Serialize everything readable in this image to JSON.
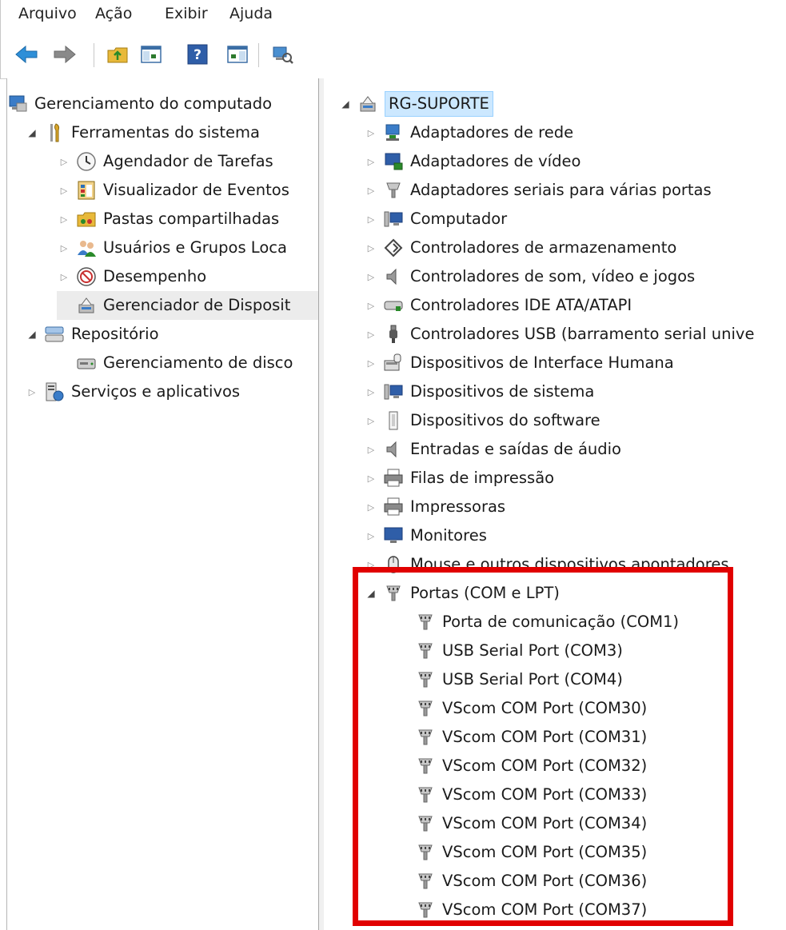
{
  "menu": [
    "Arquivo",
    "Ação",
    "Exibir",
    "Ajuda"
  ],
  "colors": {
    "accent_red": "#e10000",
    "selection": "#cce8ff"
  },
  "left_tree": [
    {
      "label": "Gerenciamento do computado",
      "icon": "computer-management-icon"
    },
    {
      "label": "Ferramentas do sistema",
      "icon": "tools-icon"
    },
    {
      "label": "Agendador de Tarefas",
      "icon": "clock-icon"
    },
    {
      "label": "Visualizador de Eventos",
      "icon": "event-viewer-icon"
    },
    {
      "label": "Pastas compartilhadas",
      "icon": "shared-folders-icon"
    },
    {
      "label": "Usuários e Grupos Loca",
      "icon": "users-icon"
    },
    {
      "label": "Desempenho",
      "icon": "performance-icon"
    },
    {
      "label": "Gerenciador de Disposit",
      "icon": "device-manager-icon"
    },
    {
      "label": "Repositório",
      "icon": "storage-icon"
    },
    {
      "label": "Gerenciamento de disco",
      "icon": "disk-icon"
    },
    {
      "label": "Serviços e aplicativos",
      "icon": "services-icon"
    }
  ],
  "right_tree": {
    "root": {
      "label": "RG-SUPORTE",
      "icon": "computer-icon"
    },
    "categories": [
      {
        "label": "Adaptadores de rede",
        "icon": "network-adapter-icon"
      },
      {
        "label": "Adaptadores de vídeo",
        "icon": "display-adapter-icon"
      },
      {
        "label": "Adaptadores seriais para várias portas",
        "icon": "serial-adapter-icon"
      },
      {
        "label": "Computador",
        "icon": "computer-icon"
      },
      {
        "label": "Controladores de armazenamento",
        "icon": "storage-controller-icon"
      },
      {
        "label": "Controladores de som, vídeo e jogos",
        "icon": "speaker-icon"
      },
      {
        "label": "Controladores IDE ATA/ATAPI",
        "icon": "ide-icon"
      },
      {
        "label": "Controladores USB (barramento serial unive",
        "icon": "usb-icon"
      },
      {
        "label": "Dispositivos de Interface Humana",
        "icon": "hid-icon"
      },
      {
        "label": "Dispositivos de sistema",
        "icon": "system-device-icon"
      },
      {
        "label": "Dispositivos do software",
        "icon": "software-device-icon"
      },
      {
        "label": "Entradas e saídas de áudio",
        "icon": "audio-icon"
      },
      {
        "label": "Filas de impressão",
        "icon": "printer-queue-icon"
      },
      {
        "label": "Impressoras",
        "icon": "printer-icon"
      },
      {
        "label": "Monitores",
        "icon": "monitor-icon"
      },
      {
        "label": "Mouse e outros dispositivos apontadores",
        "icon": "mouse-icon"
      }
    ],
    "ports_label": "Portas (COM e LPT)",
    "ports": [
      "Porta de comunicação (COM1)",
      "USB Serial Port (COM3)",
      "USB Serial Port (COM4)",
      "VScom COM Port (COM30)",
      "VScom COM Port (COM31)",
      "VScom COM Port (COM32)",
      "VScom COM Port (COM33)",
      "VScom COM Port (COM34)",
      "VScom COM Port (COM35)",
      "VScom COM Port (COM36)",
      "VScom COM Port (COM37)"
    ]
  }
}
